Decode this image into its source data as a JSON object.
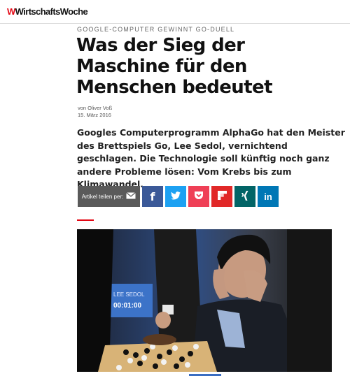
{
  "header": {
    "logo_mark": "W",
    "logo_text": "WirtschaftsWoche",
    "brand_color": "#e30613"
  },
  "article": {
    "kicker": "GOOGLE-COMPUTER GEWINNT GO-DUELL",
    "title": "Was der Sieg der Maschine für den Menschen bedeutet",
    "author": "von Oliver Voß",
    "date": "15. März 2016",
    "lead": "Googles Computerprogramm AlphaGo hat den Meister des Brettspiels Go, Lee Sedol, vernichtend geschlagen. Die Technologie soll künftig noch ganz andere Probleme lösen: Vom Krebs bis zum Klimawandel."
  },
  "share": {
    "label": "Artikel teilen per:",
    "buttons": [
      {
        "name": "facebook",
        "glyph": "f",
        "color": "#3b5998"
      },
      {
        "name": "twitter",
        "glyph": "t",
        "color": "#1da1f2"
      },
      {
        "name": "pocket",
        "glyph": "p",
        "color": "#ef3f56"
      },
      {
        "name": "flipboard",
        "glyph": "F",
        "color": "#e12828"
      },
      {
        "name": "xing",
        "glyph": "x",
        "color": "#026466"
      },
      {
        "name": "linkedin",
        "glyph": "in",
        "color": "#0077b5"
      }
    ]
  },
  "photo": {
    "scoreboard_lines": [
      "LEE SEDOL",
      "00:01:00"
    ]
  }
}
